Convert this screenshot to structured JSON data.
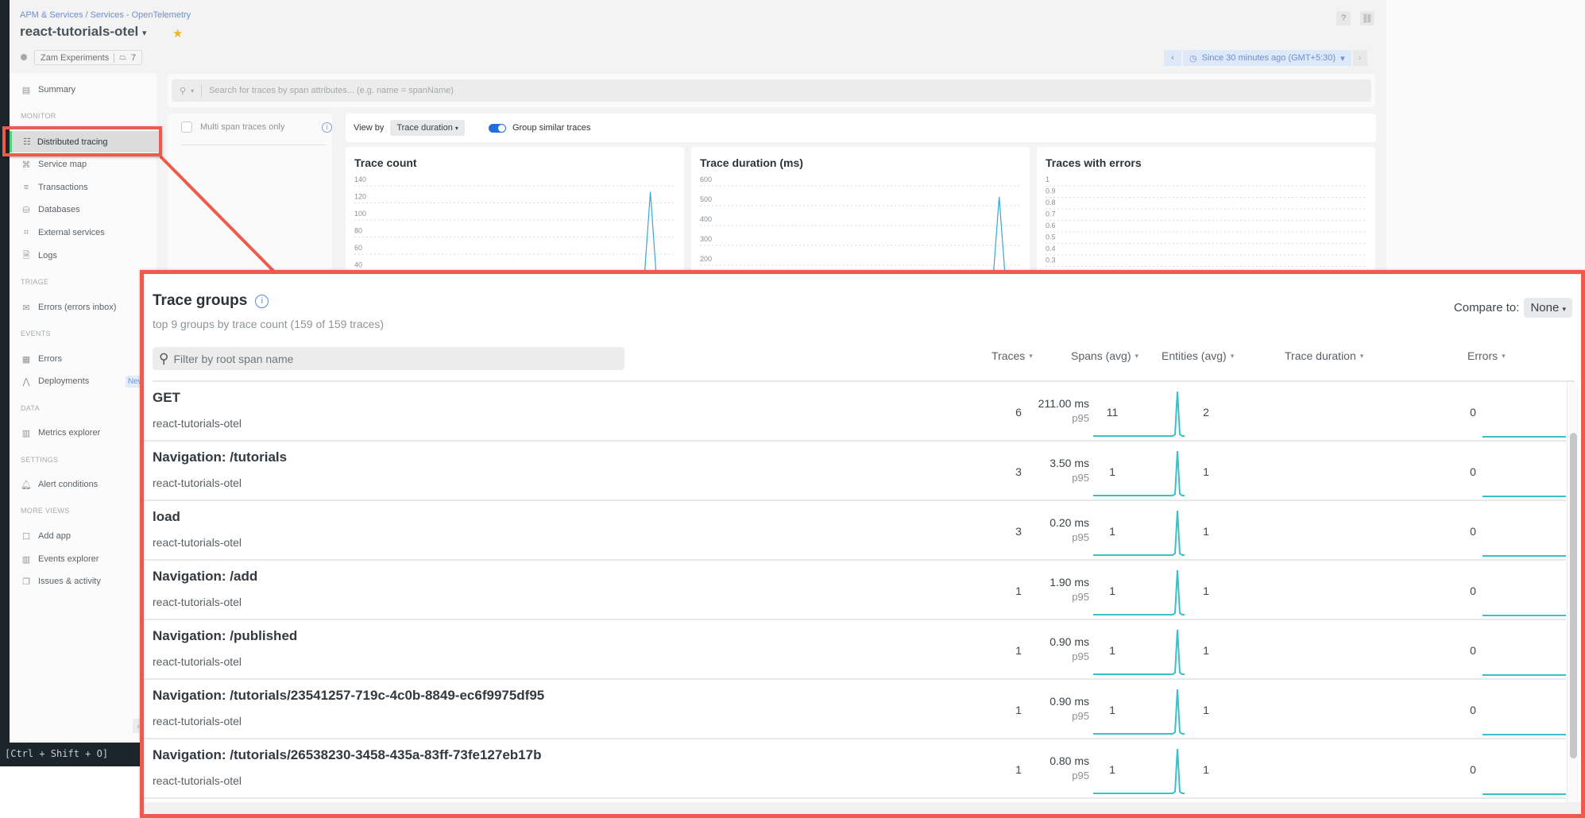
{
  "app": {
    "breadcrumb": "APM & Services / Services - OpenTelemetry",
    "title": "react-tutorials-otel",
    "title_caret": "▾",
    "favorite_icon": "star-icon",
    "account_tag": "Zam Experiments",
    "tag_count": "7",
    "help_icon": "?",
    "link_icon": "🔗",
    "time_picker": {
      "prev": "‹",
      "label": "Since 30 minutes ago (GMT+5:30)",
      "caret": "▾",
      "next": "›"
    },
    "keyboard_hint": "[Ctrl + Shift + O]",
    "collapse_icon": "›"
  },
  "sidebar": {
    "summary": "Summary",
    "sections": {
      "monitor": "MONITOR",
      "triage": "TRIAGE",
      "events": "EVENTS",
      "data": "DATA",
      "settings": "SETTINGS",
      "more_views": "MORE VIEWS"
    },
    "items": {
      "distributed_tracing": "Distributed tracing",
      "service_map": "Service map",
      "transactions": "Transactions",
      "databases": "Databases",
      "external_services": "External services",
      "logs": "Logs",
      "errors_inbox": "Errors (errors inbox)",
      "errors": "Errors",
      "deployments": "Deployments",
      "metrics_explorer": "Metrics explorer",
      "alert_conditions": "Alert conditions",
      "add_app": "Add app",
      "events_explorer": "Events explorer",
      "issues_activity": "Issues & activity"
    },
    "new_badge": "New"
  },
  "search": {
    "placeholder": "Search for traces by span attributes... (e.g. name = spanName)"
  },
  "filters": {
    "multi_span_label": "Multi span traces only",
    "multi_span_checked": false
  },
  "view_by": {
    "label": "View by",
    "selected": "Trace duration",
    "group_similar_label": "Group similar traces",
    "group_similar_on": true
  },
  "charts": [
    {
      "title": "Trace count",
      "ticks": [
        "140",
        "120",
        "100",
        "80",
        "60",
        "40"
      ],
      "ymax": 140,
      "ymin": 40,
      "peak_value": 133,
      "peak_pos": 0.92
    },
    {
      "title": "Trace duration (ms)",
      "ticks": [
        "600",
        "500",
        "400",
        "300",
        "200"
      ],
      "ymax": 600,
      "ymin": 200,
      "peak_value": 545,
      "peak_pos": 0.93
    },
    {
      "title": "Traces with errors",
      "ticks": [
        "1",
        "0.9",
        "0.8",
        "0.7",
        "0.6",
        "0.5",
        "0.4",
        "0.3"
      ],
      "ymax": 1,
      "ymin": 0.3,
      "peak_value": null,
      "peak_pos": null
    }
  ],
  "trace_groups": {
    "title": "Trace groups",
    "subtitle": "top 9 groups by trace count (159 of 159 traces)",
    "compare_label": "Compare to:",
    "compare_value": "None",
    "filter_placeholder": "Filter by root span name",
    "columns": {
      "traces": "Traces",
      "spans": "Spans (avg)",
      "entities": "Entities (avg)",
      "duration": "Trace duration",
      "errors": "Errors"
    },
    "sparkline_color": "#3bbfc9",
    "rows": [
      {
        "name": "GET",
        "entity": "react-tutorials-otel",
        "traces": "6",
        "spans": "11",
        "entities": "2",
        "duration": "211.00 ms",
        "percentile": "p95",
        "errors": "0"
      },
      {
        "name": "Navigation: /tutorials",
        "entity": "react-tutorials-otel",
        "traces": "3",
        "spans": "1",
        "entities": "1",
        "duration": "3.50 ms",
        "percentile": "p95",
        "errors": "0"
      },
      {
        "name": "load",
        "entity": "react-tutorials-otel",
        "traces": "3",
        "spans": "1",
        "entities": "1",
        "duration": "0.20 ms",
        "percentile": "p95",
        "errors": "0"
      },
      {
        "name": "Navigation: /add",
        "entity": "react-tutorials-otel",
        "traces": "1",
        "spans": "1",
        "entities": "1",
        "duration": "1.90 ms",
        "percentile": "p95",
        "errors": "0"
      },
      {
        "name": "Navigation: /published",
        "entity": "react-tutorials-otel",
        "traces": "1",
        "spans": "1",
        "entities": "1",
        "duration": "0.90 ms",
        "percentile": "p95",
        "errors": "0"
      },
      {
        "name": "Navigation: /tutorials/23541257-719c-4c0b-8849-ec6f9975df95",
        "entity": "react-tutorials-otel",
        "traces": "1",
        "spans": "1",
        "entities": "1",
        "duration": "0.90 ms",
        "percentile": "p95",
        "errors": "0"
      },
      {
        "name": "Navigation: /tutorials/26538230-3458-435a-83ff-73fe127eb17b",
        "entity": "react-tutorials-otel",
        "traces": "1",
        "spans": "1",
        "entities": "1",
        "duration": "0.80 ms",
        "percentile": "p95",
        "errors": "0"
      }
    ]
  },
  "highlight_color": "#ee5a4b"
}
